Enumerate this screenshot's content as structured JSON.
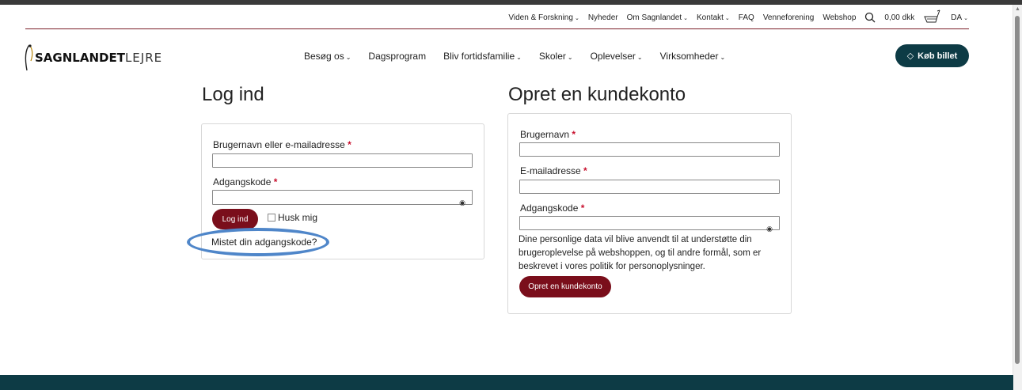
{
  "utility_nav": {
    "items": [
      {
        "label": "Viden & Forskning",
        "dropdown": true
      },
      {
        "label": "Nyheder",
        "dropdown": false
      },
      {
        "label": "Om Sagnlandet",
        "dropdown": true
      },
      {
        "label": "Kontakt",
        "dropdown": true
      },
      {
        "label": "FAQ",
        "dropdown": false
      },
      {
        "label": "Venneforening",
        "dropdown": false
      },
      {
        "label": "Webshop",
        "dropdown": false
      }
    ],
    "cart_total": "0,00 dkk",
    "language": "DA",
    "search_icon": "search-icon",
    "cart_icon": "cart-icon"
  },
  "logo": {
    "bold": "SAGNLANDET",
    "light": "LEJRE"
  },
  "main_nav": {
    "items": [
      {
        "label": "Besøg os",
        "dropdown": true
      },
      {
        "label": "Dagsprogram",
        "dropdown": false
      },
      {
        "label": "Bliv fortidsfamilie",
        "dropdown": true
      },
      {
        "label": "Skoler",
        "dropdown": true
      },
      {
        "label": "Oplevelser",
        "dropdown": true
      },
      {
        "label": "Virksomheder",
        "dropdown": true
      }
    ]
  },
  "buy_button": {
    "label": "Køb billet",
    "icon": "ticket-icon"
  },
  "login": {
    "heading": "Log ind",
    "username_label": "Brugernavn eller e-mailadresse",
    "password_label": "Adgangskode",
    "required_marker": "*",
    "submit_label": "Log ind",
    "remember_label": "Husk mig",
    "lost_password": "Mistet din adgangskode?"
  },
  "register": {
    "heading": "Opret en kundekonto",
    "username_label": "Brugernavn",
    "email_label": "E-mailadresse",
    "password_label": "Adgangskode",
    "required_marker": "*",
    "privacy_text": "Dine personlige data vil blive anvendt til at understøtte din brugeroplevelse på webshoppen, og til andre formål, som er beskrevet i vores politik for personoplysninger.",
    "submit_label": "Opret en kundekonto"
  },
  "colors": {
    "accent": "#7a0e1b",
    "dark": "#0d3b45",
    "annotation": "#4f86c9"
  }
}
